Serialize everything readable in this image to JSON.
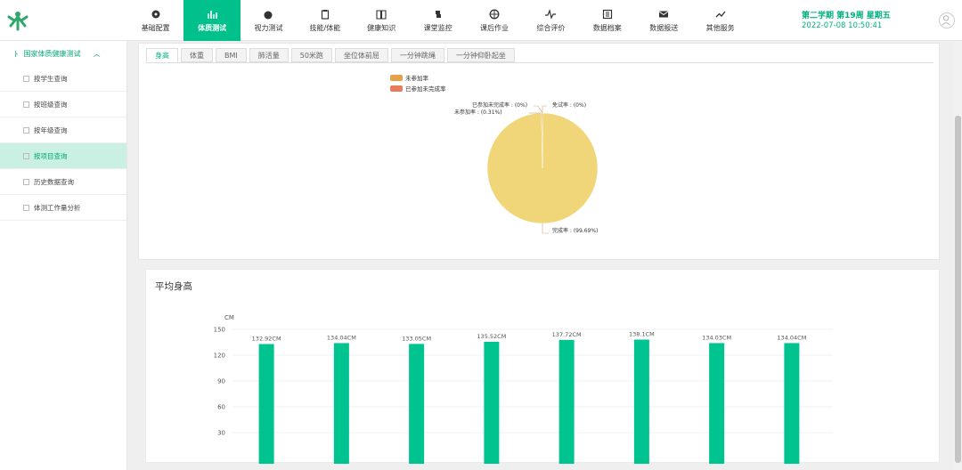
{
  "header": {
    "term": "第二学期 第19周 星期五",
    "datetime": "2022-07-08 10:50:41",
    "nav": [
      {
        "label": "基础配置",
        "icon": "gear-icon"
      },
      {
        "label": "体质测试",
        "icon": "bar-chart-icon",
        "active": true
      },
      {
        "label": "视力测试",
        "icon": "eye-icon"
      },
      {
        "label": "技能/体能",
        "icon": "clipboard-icon"
      },
      {
        "label": "健康知识",
        "icon": "book-icon"
      },
      {
        "label": "课堂监控",
        "icon": "python-icon"
      },
      {
        "label": "课后作业",
        "icon": "basketball-icon"
      },
      {
        "label": "综合评价",
        "icon": "pulse-icon"
      },
      {
        "label": "数据档案",
        "icon": "archive-icon"
      },
      {
        "label": "数据报送",
        "icon": "mail-icon"
      },
      {
        "label": "其他服务",
        "icon": "trend-icon"
      }
    ]
  },
  "sidebar": {
    "section": "国家体质健康测试",
    "items": [
      {
        "label": "按学生查询"
      },
      {
        "label": "按班级查询"
      },
      {
        "label": "按年级查询"
      },
      {
        "label": "按项目查询",
        "active": true
      },
      {
        "label": "历史数据查询"
      },
      {
        "label": "体测工作量分析"
      }
    ]
  },
  "tabs": [
    "身高",
    "体重",
    "BMI",
    "肺活量",
    "50米跑",
    "坐位体前屈",
    "一分钟跳绳",
    "一分钟仰卧起坐"
  ],
  "pie": {
    "legend": [
      {
        "label": "未参加率",
        "color": "#e8a04a"
      },
      {
        "label": "已参加未完成率",
        "color": "#e67e5e"
      }
    ],
    "labels": {
      "completed_label": "完成率 : (99.69%)",
      "not_joined_label": "未参加率 : (0.31%)",
      "joined_incomplete_label": "已参加未完成率 : (0%)",
      "exempt_label": "免试率 : (0%)"
    }
  },
  "avg": {
    "title": "平均身高"
  },
  "chart_data": [
    {
      "type": "pie",
      "categories": [
        "完成率",
        "未参加率",
        "已参加未完成率",
        "免试率"
      ],
      "values": [
        99.69,
        0.31,
        0,
        0
      ],
      "colors": [
        "#f0d679",
        "#e8a04a",
        "#e67e5e",
        "#9fcbe8"
      ],
      "legend_position": "top-left"
    },
    {
      "type": "bar",
      "categories": [
        "",
        "",
        "",
        "",
        "",
        "",
        "",
        ""
      ],
      "values": [
        132.92,
        134.04,
        133.05,
        135.52,
        137.72,
        138.1,
        134.03,
        134.04
      ],
      "data_labels": [
        "132.92CM",
        "134.04CM",
        "133.05CM",
        "135.52CM",
        "137.72CM",
        "138.1CM",
        "134.03CM",
        "134.04CM"
      ],
      "ylabel": "CM",
      "ylim": [
        0,
        150
      ],
      "yticks": [
        30,
        60,
        90,
        120,
        150
      ],
      "bar_color": "#00c490",
      "grid": true
    }
  ]
}
